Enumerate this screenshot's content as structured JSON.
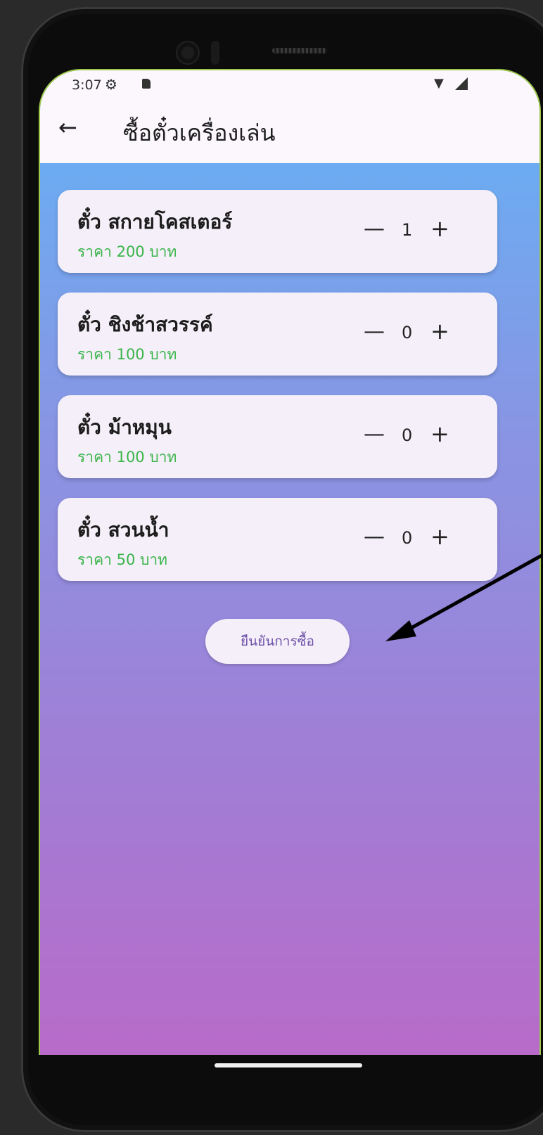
{
  "statusbar": {
    "time": "3:07"
  },
  "appbar": {
    "title": "ซื้อตั๋วเครื่องเล่น"
  },
  "tickets": [
    {
      "name": "ตั๋ว สกายโคสเตอร์",
      "price": "ราคา 200 บาท",
      "qty": "1"
    },
    {
      "name": "ตั๋ว ชิงช้าสวรรค์",
      "price": "ราคา 100 บาท",
      "qty": "0"
    },
    {
      "name": "ตั๋ว ม้าหมุน",
      "price": "ราคา 100 บาท",
      "qty": "0"
    },
    {
      "name": "ตั๋ว สวนน้ำ",
      "price": "ราคา 50 บาท",
      "qty": "0"
    }
  ],
  "stepper": {
    "minus": "—",
    "plus": "+"
  },
  "confirm_label": "ยืนยันการซื้อ",
  "colors": {
    "price_green": "#3ab54a",
    "button_text": "#6c4fa8",
    "gradient_top": "#62b3f6",
    "gradient_bottom": "#b86bc9"
  },
  "icons": [
    "back-arrow-icon",
    "settings-gear-icon",
    "sd-card-icon",
    "wifi-icon",
    "signal-icon"
  ]
}
